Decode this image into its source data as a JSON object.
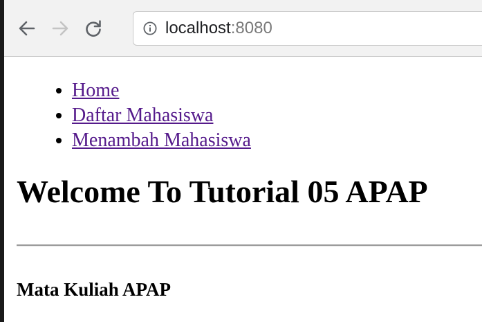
{
  "browser": {
    "back_icon": "arrow-left-icon",
    "forward_icon": "arrow-right-icon",
    "reload_icon": "reload-icon",
    "info_icon": "info-icon",
    "address": {
      "host": "localhost",
      "port": ":8080"
    }
  },
  "page": {
    "nav": [
      {
        "label": "Home"
      },
      {
        "label": "Daftar Mahasiswa"
      },
      {
        "label": "Menambah Mahasiswa"
      }
    ],
    "title": "Welcome To Tutorial 05 APAP",
    "section_title": "Mata Kuliah APAP"
  },
  "colors": {
    "link_visited": "#551a8b",
    "toolbar_bg": "#f2f2f2",
    "port_text": "#7a7a7a"
  }
}
